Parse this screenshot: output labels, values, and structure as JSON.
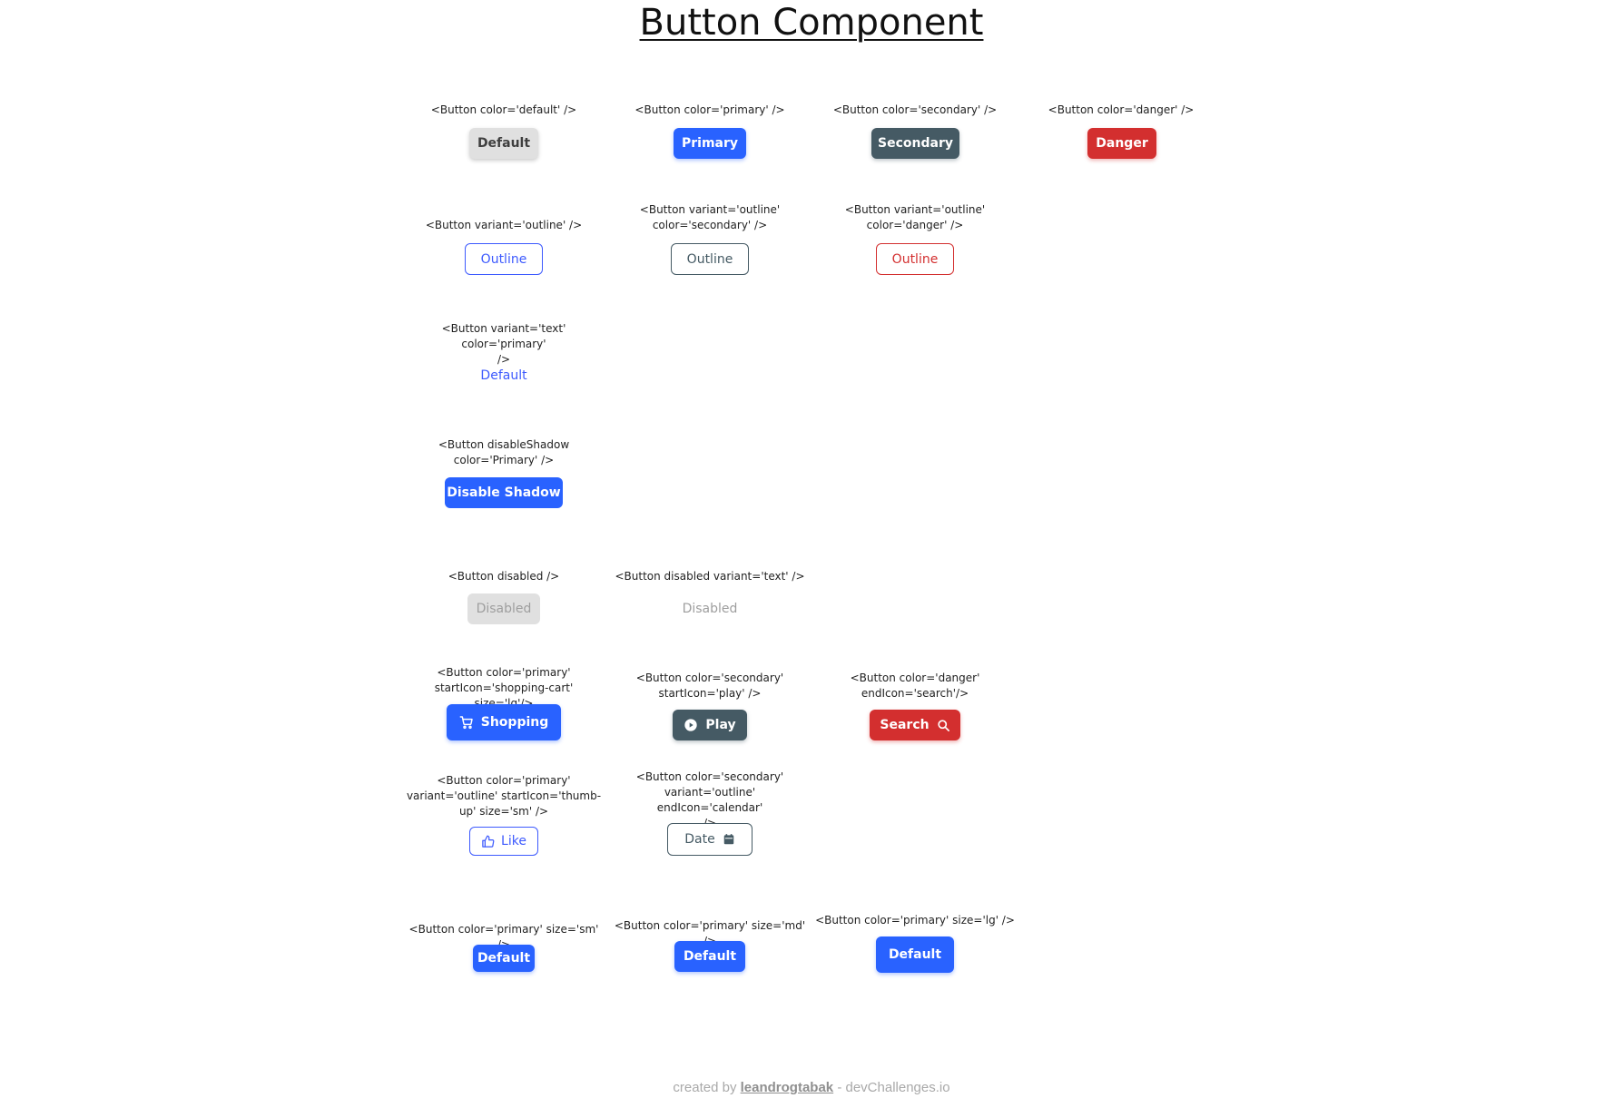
{
  "title": "Button Component",
  "colors": {
    "default": "#e0e0e0",
    "primary": "#2962ff",
    "secondary": "#455a64",
    "danger": "#d32f2f",
    "disabled_text": "#9e9e9e"
  },
  "examples": {
    "color_default": {
      "code": "<Button color='default' />",
      "label": "Default"
    },
    "color_primary": {
      "code": "<Button color='primary' />",
      "label": "Primary"
    },
    "color_secondary": {
      "code": "<Button color='secondary' />",
      "label": "Secondary"
    },
    "color_danger": {
      "code": "<Button color='danger' />",
      "label": "Danger"
    },
    "outline": {
      "code": "<Button variant='outline' />",
      "label": "Outline"
    },
    "outline_secondary": {
      "code": "<Button variant='outline'\ncolor='secondary' />",
      "label": "Outline"
    },
    "outline_danger": {
      "code": "<Button variant='outline'\ncolor='danger' />",
      "label": "Outline"
    },
    "text_primary": {
      "code": "<Button variant='text' color='primary'\n/>",
      "label": "Default"
    },
    "disable_shadow": {
      "code": "<Button disableShadow\ncolor='Primary' />",
      "label": "Disable Shadow"
    },
    "disabled": {
      "code": "<Button disabled />",
      "label": "Disabled"
    },
    "disabled_text": {
      "code": "<Button disabled variant='text' />",
      "label": "Disabled"
    },
    "shopping": {
      "code": "<Button color='primary'\nstartIcon='shopping-cart' size='lg'/>",
      "label": "Shopping",
      "icon": "shopping-cart-icon"
    },
    "play": {
      "code": "<Button color='secondary'\nstartIcon='play' />",
      "label": "Play",
      "icon": "play-icon"
    },
    "search": {
      "code": "<Button color='danger'\nendIcon='search'/>",
      "label": "Search",
      "icon": "search-icon"
    },
    "like": {
      "code": "<Button color='primary'\nvariant='outline' startIcon='thumb-\nup' size='sm' />",
      "label": "Like",
      "icon": "thumb-up-icon"
    },
    "date": {
      "code": "<Button color='secondary'\nvariant='outline' endIcon='calendar'\n/>",
      "label": "Date",
      "icon": "calendar-icon"
    },
    "size_sm": {
      "code": "<Button color='primary' size='sm' />",
      "label": "Default"
    },
    "size_md": {
      "code": "<Button color='primary' size='md' />",
      "label": "Default"
    },
    "size_lg": {
      "code": "<Button color='primary' size='lg' />",
      "label": "Default"
    }
  },
  "footer": {
    "prefix": "created by",
    "author": "leandrogtabak",
    "suffix": "- devChallenges.io"
  }
}
